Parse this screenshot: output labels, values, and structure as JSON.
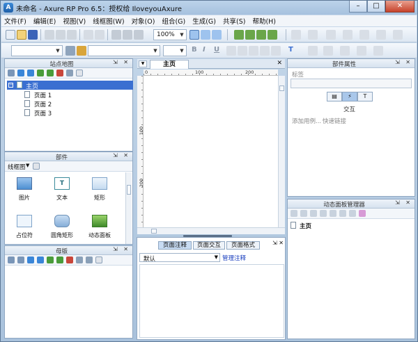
{
  "window": {
    "title": "未命名 - Axure RP Pro 6.5：授权给 IloveyouAxure",
    "min": "–",
    "max": "□",
    "close": "✕"
  },
  "menu": [
    "文件(F)",
    "编辑(E)",
    "视图(V)",
    "线框图(W)",
    "对象(O)",
    "组合(G)",
    "生成(G)",
    "共享(S)",
    "帮助(H)"
  ],
  "toolbar": {
    "zoom": "100%",
    "bold": "B",
    "italic": "I",
    "underline": "U",
    "font_color": "T"
  },
  "sitemap": {
    "title": "站点地图",
    "root": "主页",
    "pages": [
      "页面 1",
      "页面 2",
      "页面 3"
    ]
  },
  "widgets": {
    "title": "部件",
    "library": "线框图",
    "items": [
      "图片",
      "文本",
      "矩形",
      "占位符",
      "圆角矩形",
      "动态面板"
    ]
  },
  "masters": {
    "title": "母版"
  },
  "canvas": {
    "tab": "主页",
    "ruler_h": [
      "0",
      "100",
      "200"
    ],
    "ruler_v": [
      "100",
      "200"
    ]
  },
  "notes": {
    "tabs": [
      "页面注释",
      "页面交互",
      "页面格式"
    ],
    "select_value": "默认",
    "manage_link": "管理注释"
  },
  "properties": {
    "title": "部件属性",
    "label_field": "标签",
    "interaction_label": "交互",
    "add_case": "添加用例...",
    "quick_link": "快速链接"
  },
  "dynamic_panel": {
    "title": "动态面板管理器",
    "root": "主页"
  },
  "panel_buttons": "⇲ ✕"
}
